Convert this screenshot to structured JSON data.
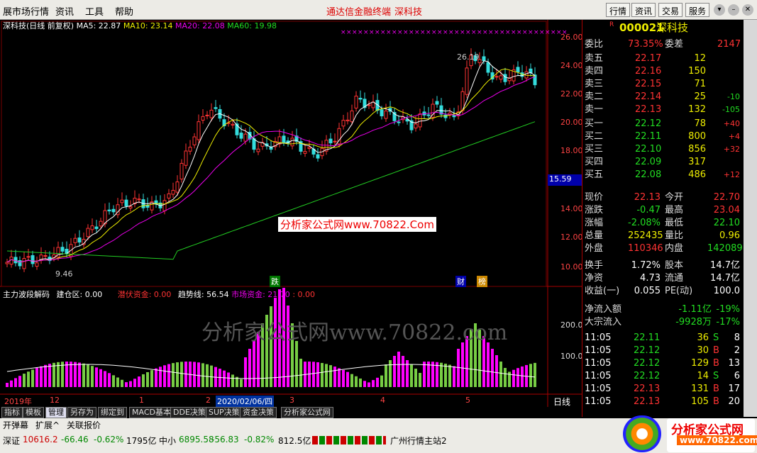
{
  "menu": {
    "items": [
      "展市场行情",
      "资讯",
      "工具",
      "帮助"
    ],
    "title": "通达信金融终端",
    "title2": "深科技",
    "buttons": [
      "行情",
      "资讯",
      "交易",
      "服务"
    ]
  },
  "chart": {
    "header": "深科技(日线 前复权)",
    "ma5": "MA5: 22.87",
    "ma10": "MA10: 23.14",
    "ma20": "MA20: 22.08",
    "ma60": "MA60: 19.98",
    "price_labels": [
      "26.00",
      "24.00",
      "22.00",
      "20.00",
      "18.00",
      "15.59",
      "14.00",
      "12.00",
      "10.00"
    ],
    "high_label": "26.19",
    "low_label": "9.46",
    "watermark": "分析家公式网www.70822.Com",
    "markers": [
      "跌",
      "财",
      "榜"
    ],
    "ind_header": "主力波段解码",
    "ind_jc": "建仓区: 0.00",
    "ind_qf": "潜伏资金: 0.00",
    "ind_qs": "趋势线: 56.54",
    "ind_sc": "市场资金: 21.70",
    "ind_zero": ": 0.00",
    "ind_labels": [
      "200.0",
      "100.0"
    ],
    "ind_watermark": "分析家公式网www.70822.com",
    "dates": [
      "2019年",
      "12",
      "1",
      "2",
      "2020/02/06/四",
      "3",
      "4",
      "5"
    ],
    "period": "日线"
  },
  "tabs": [
    "指标",
    "模板",
    "管理",
    "另存为",
    "绑定到",
    "MACD基本",
    "DDE决策",
    "SUP决策",
    "资金决策",
    "分析家公式网"
  ],
  "toolbar2": [
    "开弹幕",
    "扩展^",
    "关联报价"
  ],
  "quote": {
    "code": "000021",
    "name": "深科技",
    "wb_label": "委比",
    "wb": "73.35%",
    "wc_label": "委差",
    "wc": "2147",
    "asks": [
      [
        "卖五",
        "22.17",
        "12",
        ""
      ],
      [
        "卖四",
        "22.16",
        "150",
        ""
      ],
      [
        "卖三",
        "22.15",
        "71",
        ""
      ],
      [
        "卖二",
        "22.14",
        "25",
        "-10"
      ],
      [
        "卖一",
        "22.13",
        "132",
        "-105"
      ]
    ],
    "bids": [
      [
        "买一",
        "22.12",
        "78",
        "+40"
      ],
      [
        "买二",
        "22.11",
        "800",
        "+4"
      ],
      [
        "买三",
        "22.10",
        "856",
        "+32"
      ],
      [
        "买四",
        "22.09",
        "317",
        ""
      ],
      [
        "买五",
        "22.08",
        "486",
        "+12"
      ]
    ],
    "stats": [
      [
        "现价",
        "22.13",
        "今开",
        "22.70"
      ],
      [
        "涨跌",
        "-0.47",
        "最高",
        "23.04"
      ],
      [
        "涨幅",
        "-2.08%",
        "最低",
        "22.10"
      ],
      [
        "总量",
        "252435",
        "量比",
        "0.96"
      ],
      [
        "外盘",
        "110346",
        "内盘",
        "142089"
      ]
    ],
    "stats2": [
      [
        "换手",
        "1.72%",
        "股本",
        "14.7亿"
      ],
      [
        "净资",
        "4.73",
        "流通",
        "14.7亿"
      ],
      [
        "收益(一)",
        "0.055",
        "PE(动)",
        "100.0"
      ]
    ],
    "flow": [
      [
        "净流入额",
        "-1.11亿",
        "-19%"
      ],
      [
        "大宗流入",
        "-9928万",
        "-17%"
      ]
    ],
    "ticks": [
      [
        "11:05",
        "22.11",
        "36",
        "S",
        "8"
      ],
      [
        "11:05",
        "22.12",
        "30",
        "B",
        "2"
      ],
      [
        "11:05",
        "22.12",
        "129",
        "B",
        "13"
      ],
      [
        "11:05",
        "22.12",
        "14",
        "S",
        "6"
      ],
      [
        "11:05",
        "22.13",
        "131",
        "B",
        "17"
      ],
      [
        "11:05",
        "22.13",
        "105",
        "B",
        "20"
      ]
    ],
    "bottom_tabs": [
      "笔",
      "价"
    ]
  },
  "status": {
    "sz_label": "深证",
    "sz": "10616.2",
    "sz_chg": "-66.46",
    "sz_pct": "-0.62%",
    "sz_amt": "1795亿",
    "zx_label": "中小",
    "zx": "6895.58",
    "zx_chg": "-56.83",
    "zx_pct": "-0.82%",
    "zx_amt": "812.5亿",
    "server": "广州行情主站2",
    "logo": "分析家公式网",
    "logo_url": "www.70822.com"
  }
}
